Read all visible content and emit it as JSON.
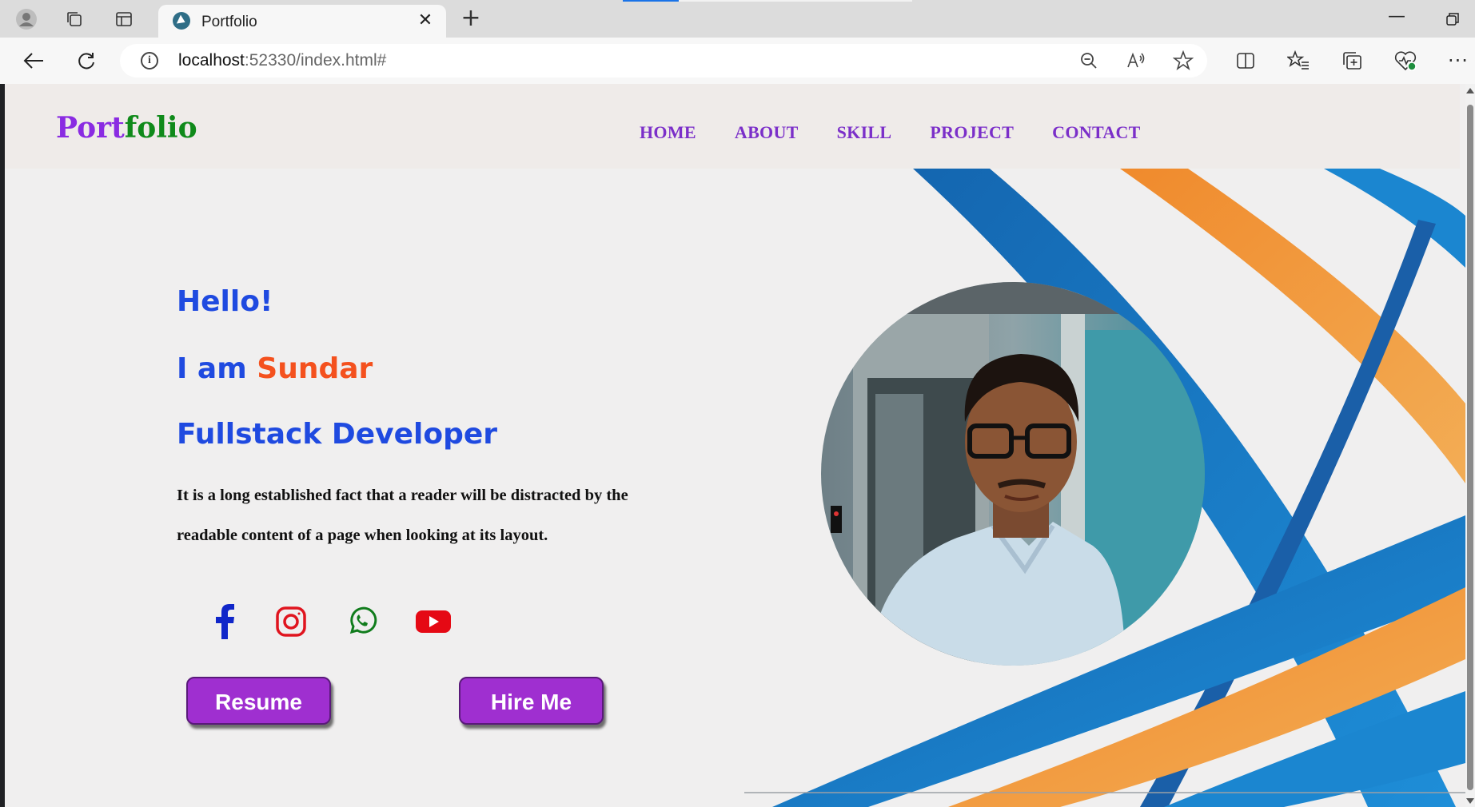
{
  "browser": {
    "tab_title": "Portfolio",
    "url_host": "localhost",
    "url_rest": ":52330/index.html#"
  },
  "site": {
    "logo_part1": "Port",
    "logo_part2": "folio",
    "nav": [
      "HOME",
      "ABOUT",
      "SKILL",
      "PROJECT",
      "CONTACT"
    ],
    "hero": {
      "greeting": "Hello!",
      "intro_prefix": "I am ",
      "name": "Sundar",
      "role": "Fullstack Developer",
      "description": "It is a long established fact that a reader will be distracted by the readable content of a page when looking at its layout."
    },
    "social_icons": [
      "facebook-icon",
      "instagram-icon",
      "whatsapp-icon",
      "youtube-icon"
    ],
    "buttons": {
      "resume": "Resume",
      "hire": "Hire Me"
    }
  },
  "colors": {
    "accent_purple": "#9f2fd0",
    "heading_blue": "#1f4ae0",
    "name_orange": "#f4511e",
    "logo_green": "#0f8a1a",
    "wave_blue": "#1b7fc9",
    "wave_orange": "#f0983a"
  }
}
